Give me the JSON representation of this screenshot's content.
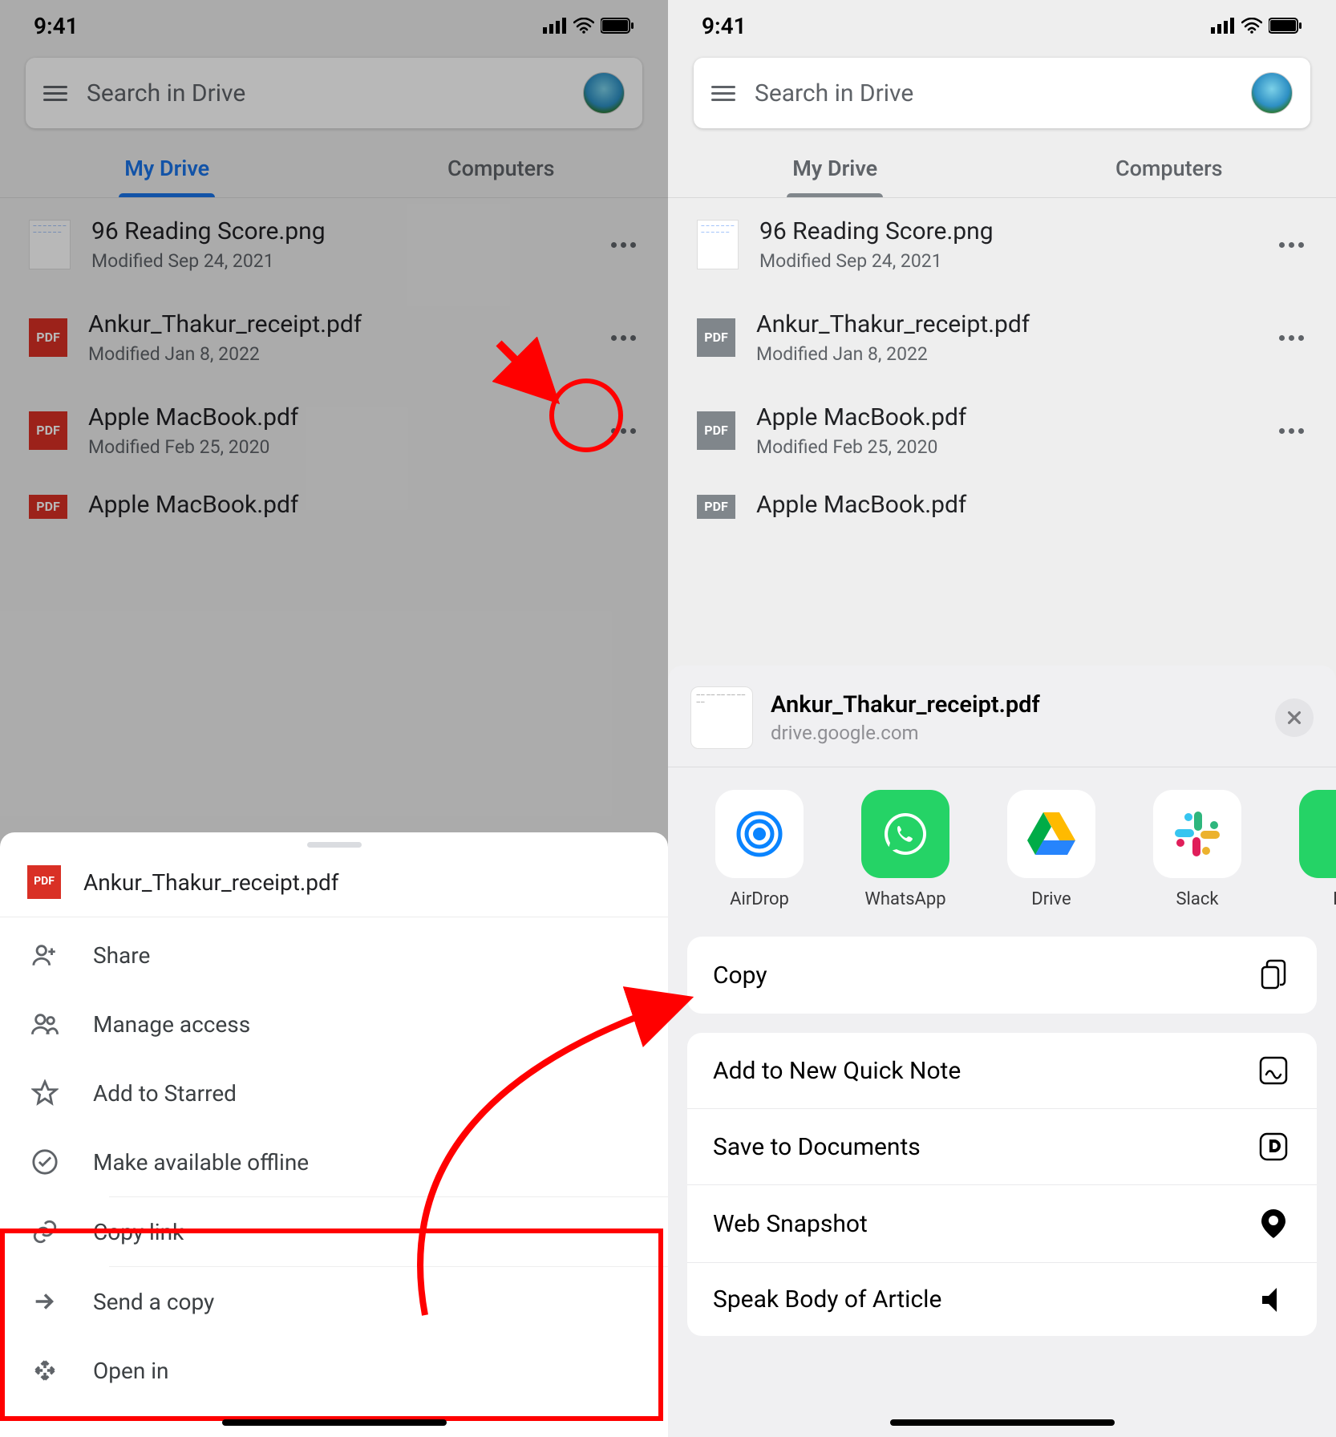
{
  "status": {
    "time": "9:41"
  },
  "search": {
    "placeholder": "Search in Drive"
  },
  "tabs": {
    "mydrive": "My Drive",
    "computers": "Computers"
  },
  "files": [
    {
      "name": "96 Reading Score.png",
      "modified": "Modified Sep 24, 2021",
      "type": "img"
    },
    {
      "name": "Ankur_Thakur_receipt.pdf",
      "modified": "Modified Jan 8, 2022",
      "type": "pdf"
    },
    {
      "name": "Apple MacBook.pdf",
      "modified": "Modified Feb 25, 2020",
      "type": "pdf"
    },
    {
      "name": "Apple MacBook.pdf",
      "modified": "",
      "type": "pdf"
    }
  ],
  "pdf_badge": "PDF",
  "sheet": {
    "file": "Ankur_Thakur_receipt.pdf",
    "items": {
      "share": "Share",
      "manage": "Manage access",
      "star": "Add to Starred",
      "offline": "Make available offline",
      "copylink": "Copy link",
      "sendcopy": "Send a copy",
      "openin": "Open in"
    }
  },
  "share": {
    "title": "Ankur_Thakur_receipt.pdf",
    "subtitle": "drive.google.com",
    "apps": {
      "airdrop": "AirDrop",
      "whatsapp": "WhatsApp",
      "drive": "Drive",
      "slack": "Slack",
      "extra": "Bu"
    },
    "actions": {
      "copy": "Copy",
      "quicknote": "Add to New Quick Note",
      "savedocs": "Save to Documents",
      "websnap": "Web Snapshot",
      "speak": "Speak Body of Article"
    }
  }
}
